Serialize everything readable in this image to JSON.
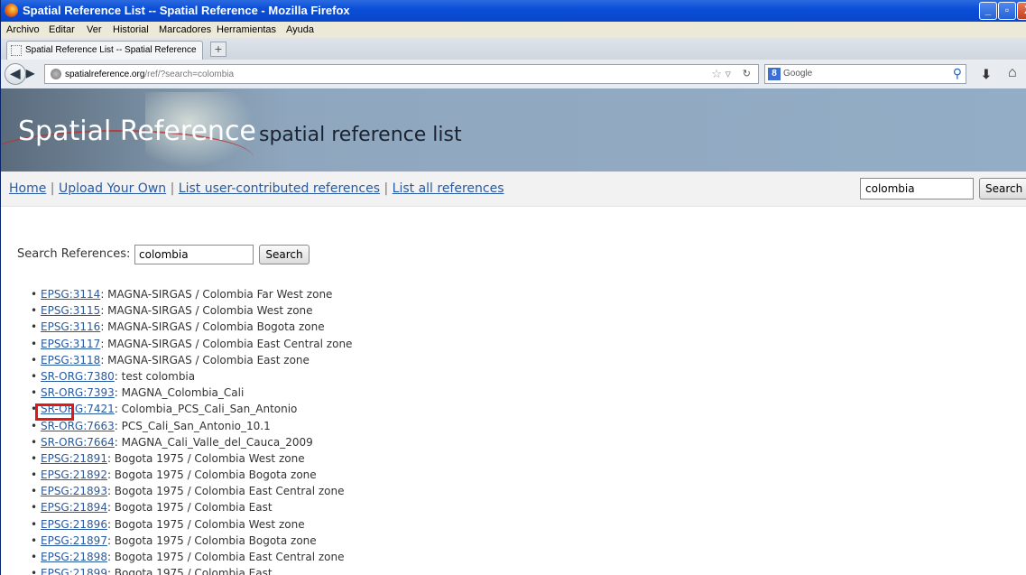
{
  "window": {
    "title": "Spatial Reference List -- Spatial Reference - Mozilla Firefox",
    "minimize": "_",
    "restore": "▫",
    "close": "X"
  },
  "menu": [
    "Archivo",
    "Editar",
    "Ver",
    "Historial",
    "Marcadores",
    "Herramientas",
    "Ayuda"
  ],
  "tab": {
    "title": "Spatial Reference List -- Spatial Reference",
    "new_tab": "+"
  },
  "nav": {
    "url_host": "spatialreference.org",
    "url_path": "/ref/?search=colombia",
    "search_engine": "Google"
  },
  "header": {
    "site_name": "Spatial Reference",
    "subtitle": "spatial reference list"
  },
  "links": {
    "home": "Home",
    "upload": "Upload Your Own",
    "user_contributed": "List user-contributed references",
    "all": "List all references",
    "separator": " | "
  },
  "top_search": {
    "value": "colombia",
    "button": "Search"
  },
  "search_form": {
    "label": "Search References:",
    "value": "colombia",
    "button": "Search"
  },
  "results": [
    {
      "code": "EPSG:3114",
      "name": ": MAGNA-SIRGAS / Colombia Far West zone"
    },
    {
      "code": "EPSG:3115",
      "name": ": MAGNA-SIRGAS / Colombia West zone"
    },
    {
      "code": "EPSG:3116",
      "name": ": MAGNA-SIRGAS / Colombia Bogota zone"
    },
    {
      "code": "EPSG:3117",
      "name": ": MAGNA-SIRGAS / Colombia East Central zone"
    },
    {
      "code": "EPSG:3118",
      "name": ": MAGNA-SIRGAS / Colombia East zone"
    },
    {
      "code": "SR-ORG:7380",
      "name": ": test colombia"
    },
    {
      "code": "SR-ORG:7393",
      "name": ": MAGNA_Colombia_Cali"
    },
    {
      "code": "SR-ORG:7421",
      "name": ": Colombia_PCS_Cali_San_Antonio"
    },
    {
      "code": "SR-ORG:7663",
      "name": ": PCS_Cali_San_Antonio_10.1"
    },
    {
      "code": "SR-ORG:7664",
      "name": ": MAGNA_Cali_Valle_del_Cauca_2009"
    },
    {
      "code": "EPSG:21891",
      "name": ": Bogota 1975 / Colombia West zone"
    },
    {
      "code": "EPSG:21892",
      "name": ": Bogota 1975 / Colombia Bogota zone"
    },
    {
      "code": "EPSG:21893",
      "name": ": Bogota 1975 / Colombia East Central zone"
    },
    {
      "code": "EPSG:21894",
      "name": ": Bogota 1975 / Colombia East"
    },
    {
      "code": "EPSG:21896",
      "name": ": Bogota 1975 / Colombia West zone"
    },
    {
      "code": "EPSG:21897",
      "name": ": Bogota 1975 / Colombia Bogota zone"
    },
    {
      "code": "EPSG:21898",
      "name": ": Bogota 1975 / Colombia East Central zone"
    },
    {
      "code": "EPSG:21899",
      "name": ": Bogota 1975 / Colombia East"
    }
  ],
  "colors": {
    "titlebar": "#0b4fd8",
    "link": "#2a5aa0",
    "highlight": "#e01818",
    "header_bg": "#93adc6"
  }
}
